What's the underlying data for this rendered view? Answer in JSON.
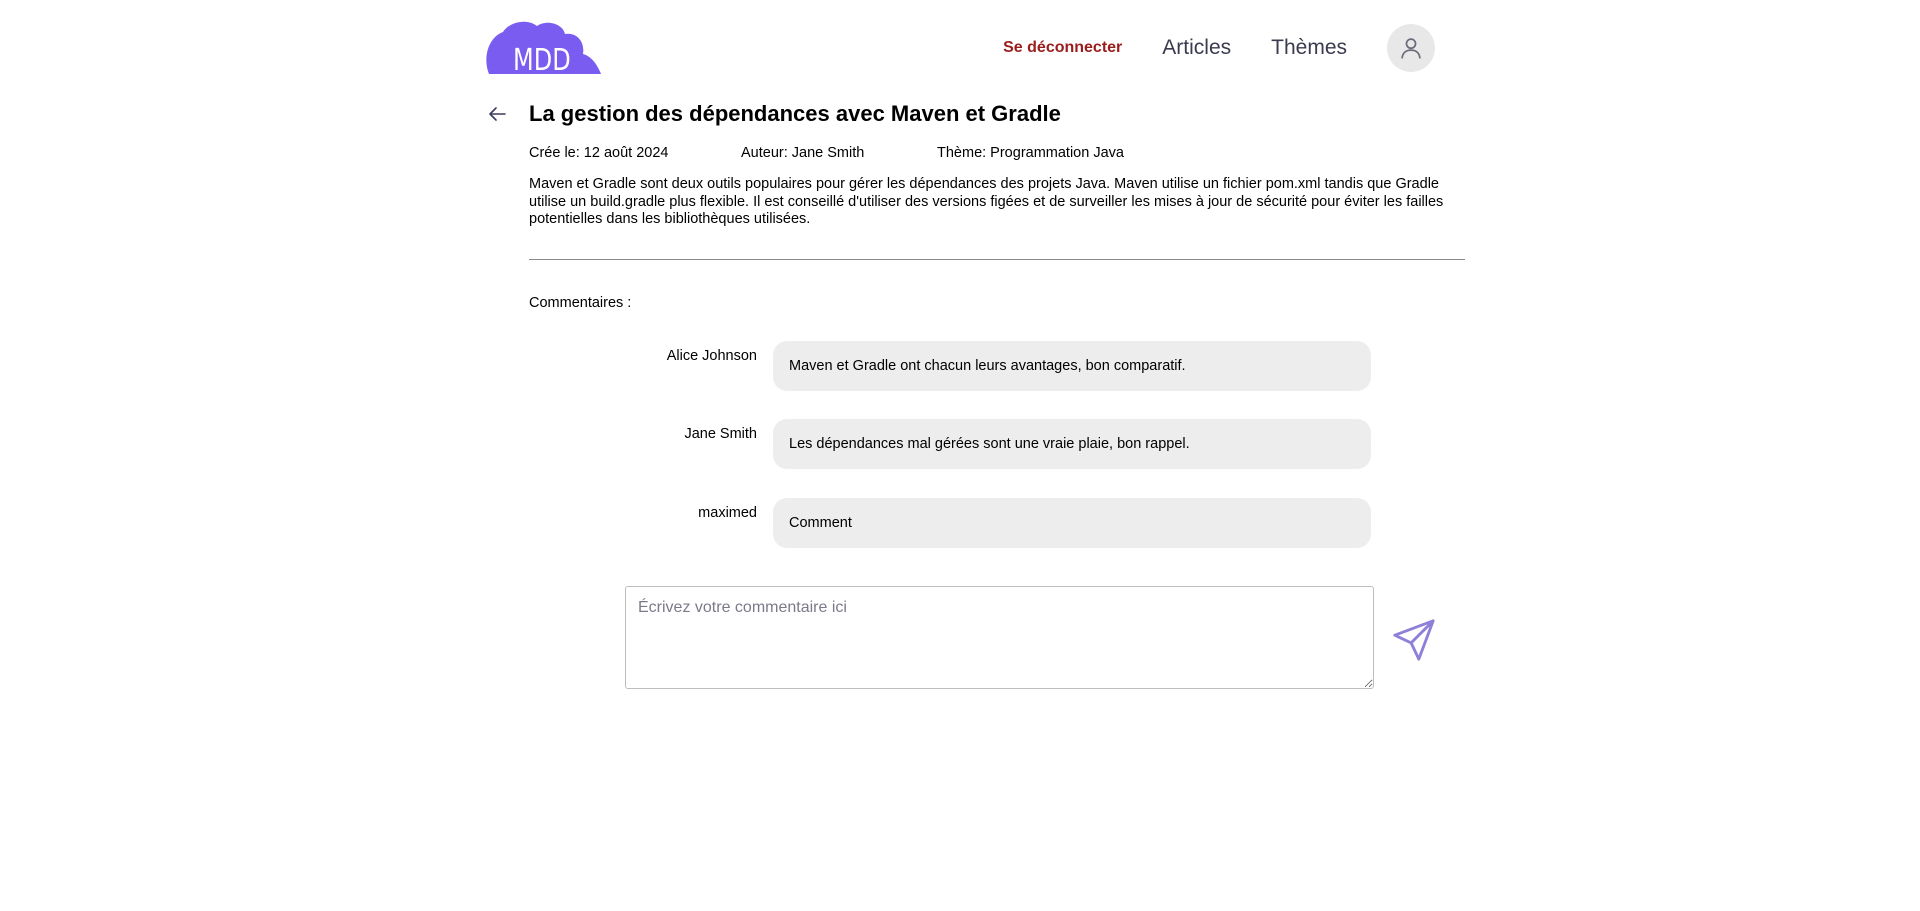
{
  "header": {
    "logo_text": "MDD",
    "logout_label": "Se déconnecter",
    "nav": {
      "articles": "Articles",
      "themes": "Thèmes"
    },
    "icons": {
      "profile": "user-icon"
    },
    "colors": {
      "brand": "#7b5cf0",
      "logout": "#9b1c1c"
    }
  },
  "article": {
    "back_icon": "arrow-left-icon",
    "title": "La gestion des dépendances avec Maven et Gradle",
    "created": "Crée le: 12 août 2024",
    "author": "Auteur: Jane Smith",
    "theme": "Thème: Programmation Java",
    "content": "Maven et Gradle sont deux outils populaires pour gérer les dépendances des projets Java. Maven utilise un fichier pom.xml tandis que Gradle utilise un build.gradle plus flexible. Il est conseillé d'utiliser des versions figées et de surveiller les mises à jour de sécurité pour éviter les failles potentielles dans les bibliothèques utilisées."
  },
  "comments": {
    "label": "Commentaires :",
    "items": [
      {
        "author": "Alice Johnson",
        "text": "Maven et Gradle ont chacun leurs avantages, bon comparatif."
      },
      {
        "author": "Jane Smith",
        "text": "Les dépendances mal gérées sont une vraie plaie, bon rappel."
      },
      {
        "author": "maximed",
        "text": "Comment"
      }
    ],
    "input_placeholder": "Écrivez votre commentaire ici",
    "input_value": "",
    "send_icon": "send-icon",
    "send_color": "#8f7fd8"
  }
}
